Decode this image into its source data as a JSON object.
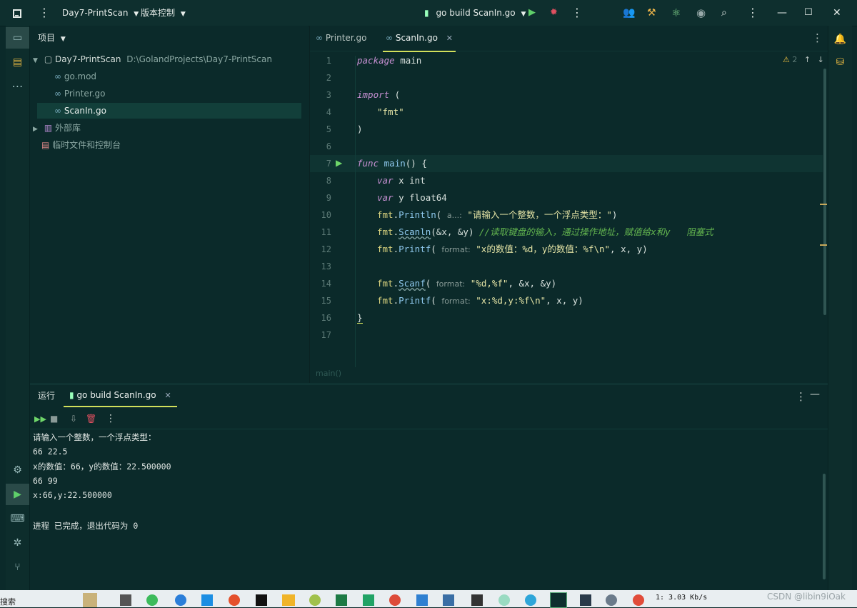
{
  "titlebar": {
    "project_name": "Day7-PrintScan",
    "vcs_label": "版本控制",
    "run_config": "go build ScanIn.go"
  },
  "project_panel": {
    "header": "项目",
    "root": {
      "name": "Day7-PrintScan",
      "path": "D:\\GolandProjects\\Day7-PrintScan"
    },
    "files": [
      "go.mod",
      "Printer.go",
      "ScanIn.go"
    ],
    "external_libs": "外部库",
    "scratches": "临时文件和控制台"
  },
  "editor": {
    "tabs": [
      {
        "label": "Printer.go",
        "active": false
      },
      {
        "label": "ScanIn.go",
        "active": true
      }
    ],
    "warning_count": "2",
    "breadcrumb": "main()",
    "code": {
      "l1": {
        "kw": "package",
        "rest": " main"
      },
      "l3": {
        "kw": "import",
        "rest": " ("
      },
      "l4": "\"fmt\"",
      "l5": ")",
      "l7": {
        "kw": "func",
        "name": "main",
        "rest": "() {"
      },
      "l8": {
        "kw": "var",
        "rest": " x int"
      },
      "l9": {
        "kw": "var",
        "rest": " y float64"
      },
      "l10": {
        "pkg": "fmt",
        "fn": "Println",
        "hint": "a...:",
        "str": "\"请输入一个整数，一个浮点类型：\"",
        "end": ")"
      },
      "l11": {
        "pkg": "fmt",
        "fn": "Scanln",
        "args": "(&x, &y)",
        "comment": "//读取键盘的输入，通过操作地址，赋值给x和y   阻塞式"
      },
      "l12": {
        "pkg": "fmt",
        "fn": "Printf",
        "hint": "format:",
        "str": "\"x的数值：%d，y的数值：%f\\n\"",
        "end": ", x, y)"
      },
      "l14": {
        "pkg": "fmt",
        "fn": "Scanf",
        "hint": "format:",
        "str": "\"%d,%f\"",
        "end": ", &x, &y)"
      },
      "l15": {
        "pkg": "fmt",
        "fn": "Printf",
        "hint": "format:",
        "str": "\"x:%d,y:%f\\n\"",
        "end": ", x, y)"
      },
      "l16": "}"
    },
    "line_numbers": [
      "1",
      "2",
      "3",
      "4",
      "5",
      "6",
      "7",
      "8",
      "9",
      "10",
      "11",
      "12",
      "13",
      "14",
      "15",
      "16",
      "17"
    ]
  },
  "run_panel": {
    "label": "运行",
    "tab": "go build ScanIn.go",
    "output": [
      "请输入一个整数，一个浮点类型：",
      "66 22.5",
      "x的数值：66，y的数值：22.500000",
      "66 99",
      "x:66,y:22.500000",
      "",
      "进程 已完成，退出代码为 0"
    ]
  },
  "taskbar": {
    "search": "搜索",
    "network": "1: 3.03 Kb/s",
    "watermark": "CSDN @libin9iOak"
  },
  "colors": {
    "background": "#0b2a2a",
    "accent": "#d2e05b",
    "keyword": "#c58fd1",
    "string": "#e6e5a6",
    "function": "#8fc9ee",
    "comment": "#63b54f"
  }
}
